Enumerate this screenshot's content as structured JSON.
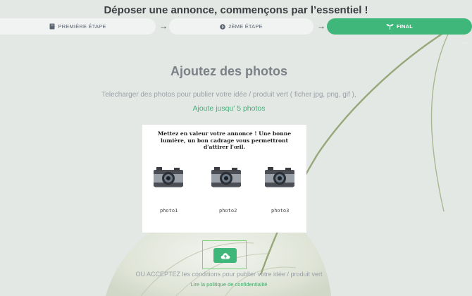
{
  "page": {
    "title": "Déposer une annonce, commençons par l’essentiel !"
  },
  "steps": [
    {
      "label": "PREMIÈRE ÉTAPE",
      "icon": "book-icon",
      "active": false
    },
    {
      "label": "2ÈME ÉTAPE",
      "icon": "chevron-circle-icon",
      "active": false
    },
    {
      "label": "FINAL",
      "icon": "sprout-icon",
      "active": true
    }
  ],
  "step_arrow": "→",
  "upload": {
    "title": "Ajoutez des photos",
    "description": "Telecharger des photos pour publier votre idée / produit vert ( ficher jpg, png, gif ),",
    "limit": "Ajoute jusqu' 5 photos",
    "card_text": "Mettez en valeur votre annonce ! Une bonne lumière, un bon cadrage vous permettront d'attirer l'œil.",
    "photos": [
      {
        "label": "photo1",
        "icon": "camera-icon"
      },
      {
        "label": "photo2",
        "icon": "camera-icon"
      },
      {
        "label": "photo3",
        "icon": "camera-icon"
      }
    ],
    "button_icon": "cloud-upload-icon"
  },
  "footer": {
    "conditions": "OU ACCEPTEZ les conditions pour publier votre idée / produit vert",
    "privacy_link": "Lire la politique de confidentialité"
  },
  "colors": {
    "accent": "#3fb77a",
    "background": "#e4e8e5",
    "step_inactive": "#f1f3f3"
  }
}
